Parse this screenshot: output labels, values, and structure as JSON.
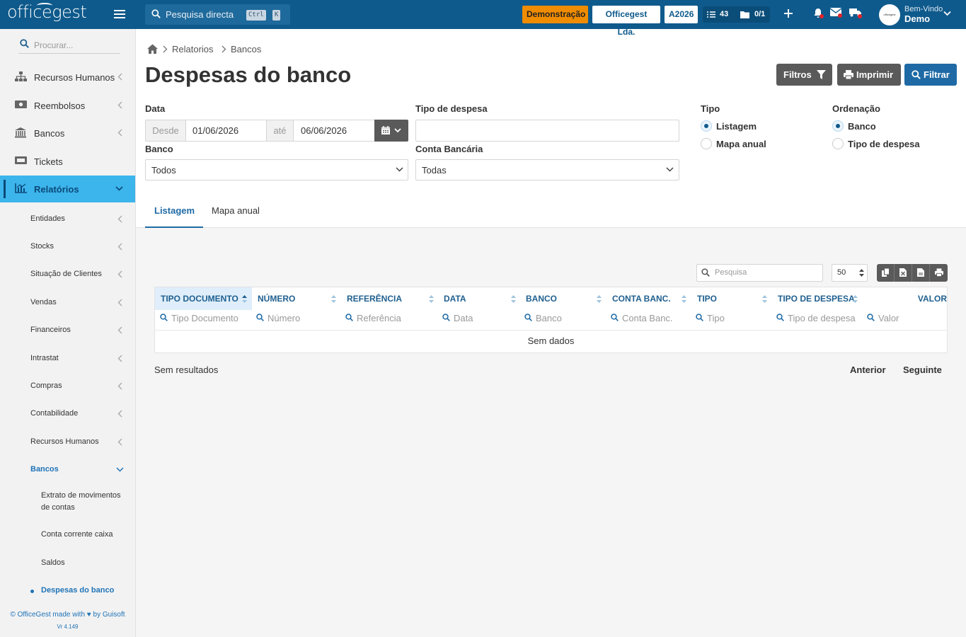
{
  "topbar": {
    "brand": "officegest",
    "search_placeholder": "Pesquisa directa",
    "shortcut_ctrl": "Ctrl",
    "shortcut_key": "K",
    "demo_badge": "Demonstração",
    "company": "Officegest Lda.",
    "year": "A2026",
    "tasks_count": "43",
    "docs_count": "0/1",
    "welcome": "Bem-Vindo",
    "user_name": "Demo",
    "avatar_text": "officegest",
    "colors": {
      "bar": "#0f5a8c",
      "demo": "#f08c00"
    }
  },
  "sidebar": {
    "search_placeholder": "Procurar...",
    "items": [
      {
        "label": "Recursos Humanos",
        "icon": "sitemap-icon"
      },
      {
        "label": "Reembolsos",
        "icon": "money-icon"
      },
      {
        "label": "Bancos",
        "icon": "bank-icon"
      },
      {
        "label": "Tickets",
        "icon": "ticket-icon"
      },
      {
        "label": "Relatórios",
        "icon": "chart-icon"
      }
    ],
    "report_items": [
      "Entidades",
      "Stocks",
      "Situação de Clientes",
      "Vendas",
      "Financeiros",
      "Intrastat",
      "Compras",
      "Contabilidade",
      "Recursos Humanos",
      "Bancos"
    ],
    "bank_items": [
      "Extrato de movimentos de contas",
      "Conta corrente caixa",
      "Saldos",
      "Despesas do banco"
    ],
    "footer": "© OfficeGest made with ♥ by Guisoft",
    "version": "Vr 4.149"
  },
  "breadcrumb": {
    "level1": "Relatorios",
    "level2": "Bancos"
  },
  "page": {
    "title": "Despesas do banco",
    "filters_button": "Filtros",
    "print_button": "Imprimir",
    "filter_button": "Filtrar"
  },
  "form": {
    "date_label": "Data",
    "from_addon": "Desde",
    "from_value": "01/06/2026",
    "to_addon": "até",
    "to_value": "06/06/2026",
    "expense_type_label": "Tipo de despesa",
    "expense_type_value": "",
    "bank_label": "Banco",
    "bank_value": "Todos",
    "account_label": "Conta Bancária",
    "account_value": "Todas",
    "type_label": "Tipo",
    "type_options": [
      "Listagem",
      "Mapa anual"
    ],
    "type_selected": "Listagem",
    "order_label": "Ordenação",
    "order_options": [
      "Banco",
      "Tipo de despesa"
    ],
    "order_selected": "Banco"
  },
  "tabs": [
    "Listagem",
    "Mapa anual"
  ],
  "grid": {
    "search_placeholder": "Pesquisa",
    "page_size": "50",
    "columns": [
      {
        "header": "TIPO DOCUMENTO",
        "filter": "Tipo Documento"
      },
      {
        "header": "NÚMERO",
        "filter": "Número"
      },
      {
        "header": "REFERÊNCIA",
        "filter": "Referência"
      },
      {
        "header": "DATA",
        "filter": "Data"
      },
      {
        "header": "BANCO",
        "filter": "Banco"
      },
      {
        "header": "CONTA BANC.",
        "filter": "Conta Banc."
      },
      {
        "header": "TIPO",
        "filter": "Tipo"
      },
      {
        "header": "TIPO DE DESPESA",
        "filter": "Tipo de despesa"
      },
      {
        "header": "VALOR",
        "filter": "Valor"
      }
    ],
    "empty_text": "Sem dados",
    "summary": "Sem resultados",
    "prev": "Anterior",
    "next": "Seguinte"
  }
}
